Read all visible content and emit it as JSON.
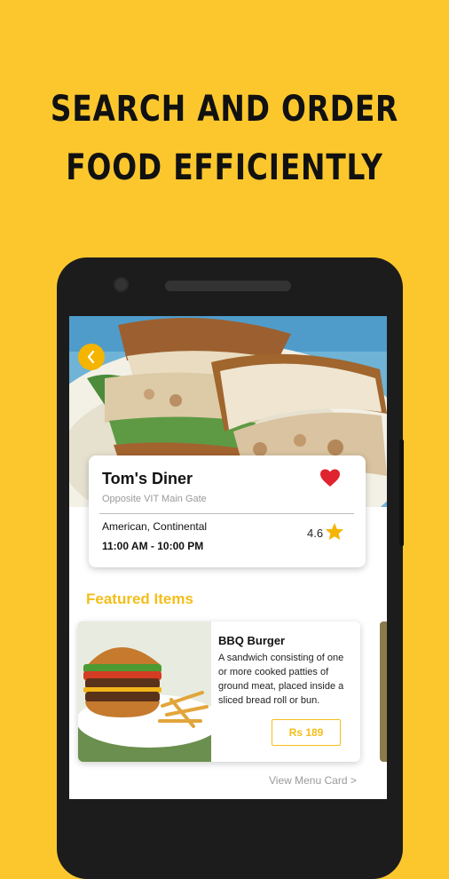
{
  "promo": {
    "headline_line1": "SEARCH AND ORDER",
    "headline_line2": "FOOD EFFICIENTLY"
  },
  "colors": {
    "background": "#fcc72d",
    "accent": "#f4be1a",
    "heart": "#e0242f",
    "star": "#f4b400"
  },
  "restaurant": {
    "name": "Tom's Diner",
    "location": "Opposite VIT Main Gate",
    "cuisine": "American, Continental",
    "hours": "11:00 AM - 10:00 PM",
    "rating": "4.6",
    "favorite_icon": "heart-icon",
    "rating_icon": "star-icon"
  },
  "featured": {
    "title": "Featured Items",
    "items": [
      {
        "name": "BBQ Burger",
        "description": "A sandwich consisting of one or more cooked patties of ground meat, placed inside a sliced bread roll or bun.",
        "price": "Rs 189"
      }
    ],
    "view_menu": "View Menu Card >"
  },
  "navigation": {
    "back_icon": "chevron-left-icon"
  }
}
